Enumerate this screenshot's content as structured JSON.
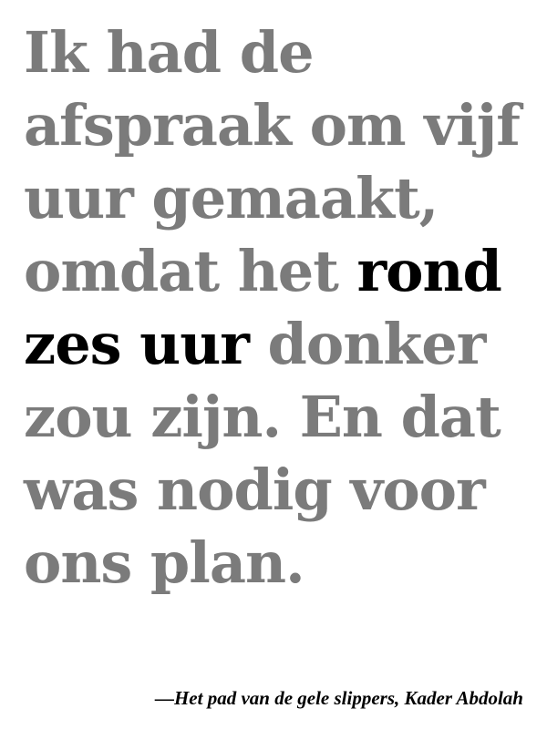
{
  "quote": {
    "line1": "Ik had de",
    "line2": "afspraak om vijf",
    "line3": "uur gemaakt,",
    "line4_before": "omdat het ",
    "line4_emph": "rond",
    "line5_emph": "zes uur",
    "line5_after": " donker",
    "line6": "zou zijn. En dat",
    "line7": "was nodig voor",
    "line8": "ons plan."
  },
  "attribution": "—Het pad van de gele slippers, Kader Abdolah",
  "colors": {
    "body_text": "#7b7b7b",
    "emphasis_text": "#000000",
    "background": "#ffffff"
  }
}
